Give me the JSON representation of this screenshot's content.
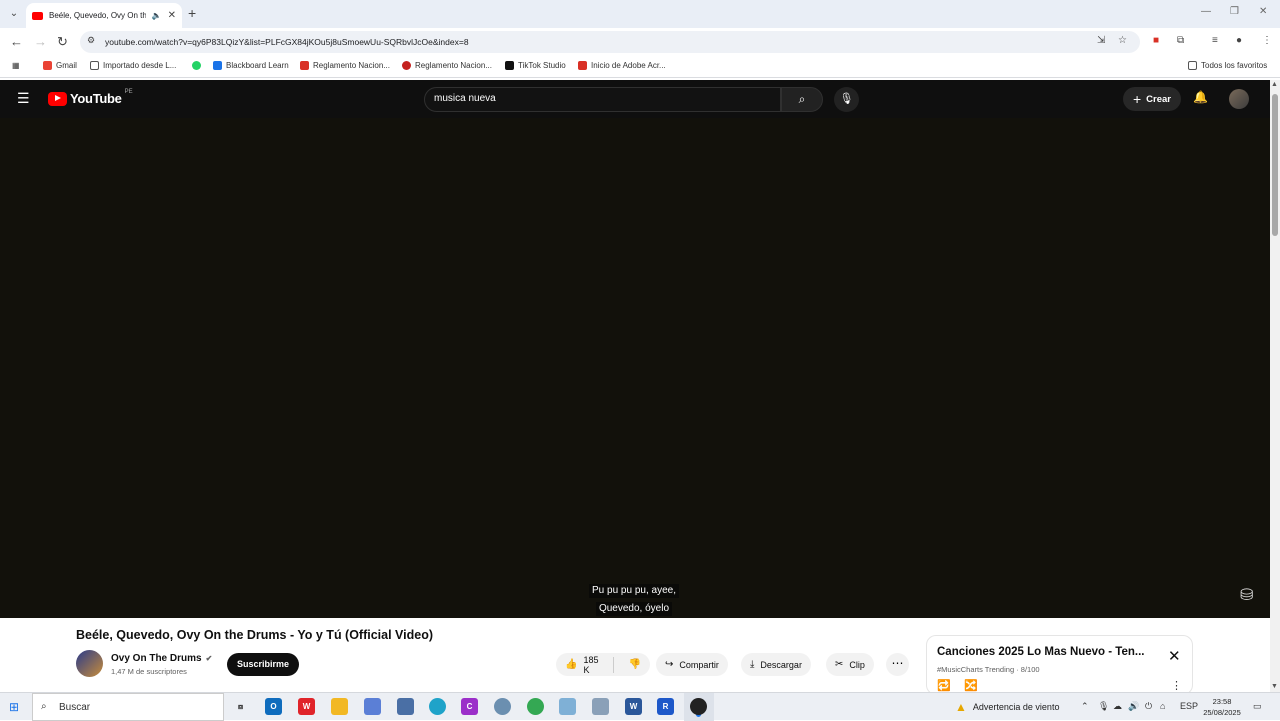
{
  "browser": {
    "tab_title": "Beéle, Quevedo, Ovy On th",
    "url": "youtube.com/watch?v=qy6P83LQizY&list=PLFcGX84jKOu5j8uSmoewUu-SQRbvlJcOe&index=8",
    "bookmarks": [
      {
        "label": "Gmail",
        "color": "#ea4335"
      },
      {
        "label": "Importado desde L...",
        "color": "#777777"
      },
      {
        "label": "",
        "color": "#25d366"
      },
      {
        "label": "Blackboard Learn",
        "color": "#1a73e8"
      },
      {
        "label": "Reglamento Nacion...",
        "color": "#d93025"
      },
      {
        "label": "Reglamento Nacion...",
        "color": "#c5221f"
      },
      {
        "label": "TikTok Studio",
        "color": "#111111"
      },
      {
        "label": "Inicio de Adobe Acr...",
        "color": "#d93025"
      }
    ],
    "all_bookmarks": "Todos los favoritos"
  },
  "youtube": {
    "logo_text": "YouTube",
    "country": "PE",
    "search_value": "musica nueva",
    "create_label": "Crear"
  },
  "video": {
    "caption_line1": "Pu pu pu pu, ayee,",
    "caption_line2": "Quevedo, óyelo",
    "title": "Beéle, Quevedo, Ovy On the Drums - Yo y Tú (Official Video)",
    "channel": "Ovy On The Drums",
    "subscribers": "1,47 M de suscriptores",
    "subscribe_label": "Suscribirme",
    "likes": "185 K",
    "share_label": "Compartir",
    "download_label": "Descargar",
    "clip_label": "Clip"
  },
  "mix": {
    "title": "Canciones 2025 Lo Mas Nuevo - Ten...",
    "subtitle": "#MusicCharts Trending · 8/100"
  },
  "taskbar": {
    "search_label": "Buscar",
    "weather": "Advertencia de viento",
    "lang": "ESP",
    "time": "23:58",
    "date": "25/08/2025",
    "apps": [
      {
        "name": "task-view",
        "label": "",
        "color": "#333333"
      },
      {
        "name": "outlook",
        "label": "O",
        "color": "#0f6cbd"
      },
      {
        "name": "wps",
        "label": "W",
        "color": "#e0242a"
      },
      {
        "name": "explorer",
        "label": "",
        "color": "#f2b824"
      },
      {
        "name": "store",
        "label": "",
        "color": "#5b7fd6"
      },
      {
        "name": "calculator",
        "label": "",
        "color": "#4a6fa5"
      },
      {
        "name": "edge",
        "label": "",
        "color": "#1fa3c9"
      },
      {
        "name": "canva",
        "label": "C",
        "color": "#9b2fc9"
      },
      {
        "name": "tool",
        "label": "",
        "color": "#6b8fb0"
      },
      {
        "name": "chrome",
        "label": "",
        "color": "#34a853"
      },
      {
        "name": "app",
        "label": "",
        "color": "#7fb0d6"
      },
      {
        "name": "notepad",
        "label": "",
        "color": "#8aa0b8"
      },
      {
        "name": "word",
        "label": "W",
        "color": "#2b579a"
      },
      {
        "name": "revit",
        "label": "R",
        "color": "#1e58c9"
      },
      {
        "name": "chrome-alt",
        "label": "",
        "color": "#222222"
      }
    ]
  }
}
